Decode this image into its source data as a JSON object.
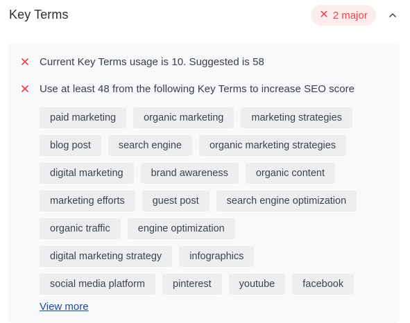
{
  "section": {
    "title": "Key Terms",
    "badge": {
      "icon": "close-icon",
      "label": "2 major",
      "color": "#e5484d",
      "background": "#fdecec"
    },
    "toggle_icon": "chevron-up-icon"
  },
  "issues": [
    {
      "icon": "error-x-icon",
      "text": "Current Key Terms usage is 10. Suggested is 58"
    },
    {
      "icon": "error-x-icon",
      "text": "Use at least 48 from the following Key Terms to increase SEO score"
    }
  ],
  "key_terms": [
    [
      "paid marketing",
      "organic marketing",
      "marketing strategies"
    ],
    [
      "blog post",
      "search engine",
      "organic marketing strategies"
    ],
    [
      "digital marketing",
      "brand awareness",
      "organic content"
    ],
    [
      "marketing efforts",
      "guest post",
      "search engine optimization"
    ],
    [
      "organic traffic",
      "engine optimization"
    ],
    [
      "digital marketing strategy",
      "infographics"
    ],
    [
      "social media platform",
      "pinterest",
      "youtube",
      "facebook"
    ]
  ],
  "view_more": "View more",
  "colors": {
    "error": "#e5484d",
    "link": "#1b4a9a",
    "panel_bg": "#f8f9fa",
    "chip_bg": "#eceeef"
  }
}
